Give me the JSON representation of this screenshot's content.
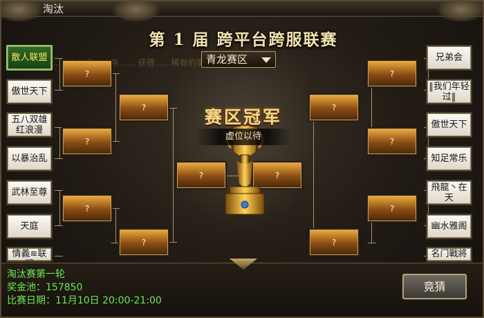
{
  "window": {
    "tab_title": "淘汰"
  },
  "header": {
    "event_title": "第 1 届  跨平台跨服联赛",
    "zone_select": "青龙赛区",
    "scroll_notice": "……  淘汰赛，击杀……                              获得……稀有的奖励……"
  },
  "champion": {
    "title": "赛区冠军",
    "name": "虚位以待"
  },
  "bracket": {
    "left_teams": [
      "散人联盟",
      "傲世天下",
      "五八双雄红浪漫",
      "以暴治乱",
      "武林至尊",
      "天庭",
      "情義≋联盟"
    ],
    "right_teams": [
      "兄弟会",
      "‖我们年轻过‖",
      "傲世天下",
      "知足常乐",
      "飛龍丶在天",
      "幽水雅阁",
      "名门戰將"
    ],
    "selected_team": "散人联盟",
    "slot_placeholder": "?"
  },
  "footer": {
    "round": "淘汰赛第一轮",
    "prize_pool": "奖金池：157850",
    "match_date": "比赛日期：11月10日 20:00-21:00",
    "bet_button": "竟猜"
  },
  "colors": {
    "accent_gold": "#f5d88a",
    "info_green": "#6ee856",
    "slot_orange": "#e9a83c",
    "selected_green": "#2d6a25"
  }
}
